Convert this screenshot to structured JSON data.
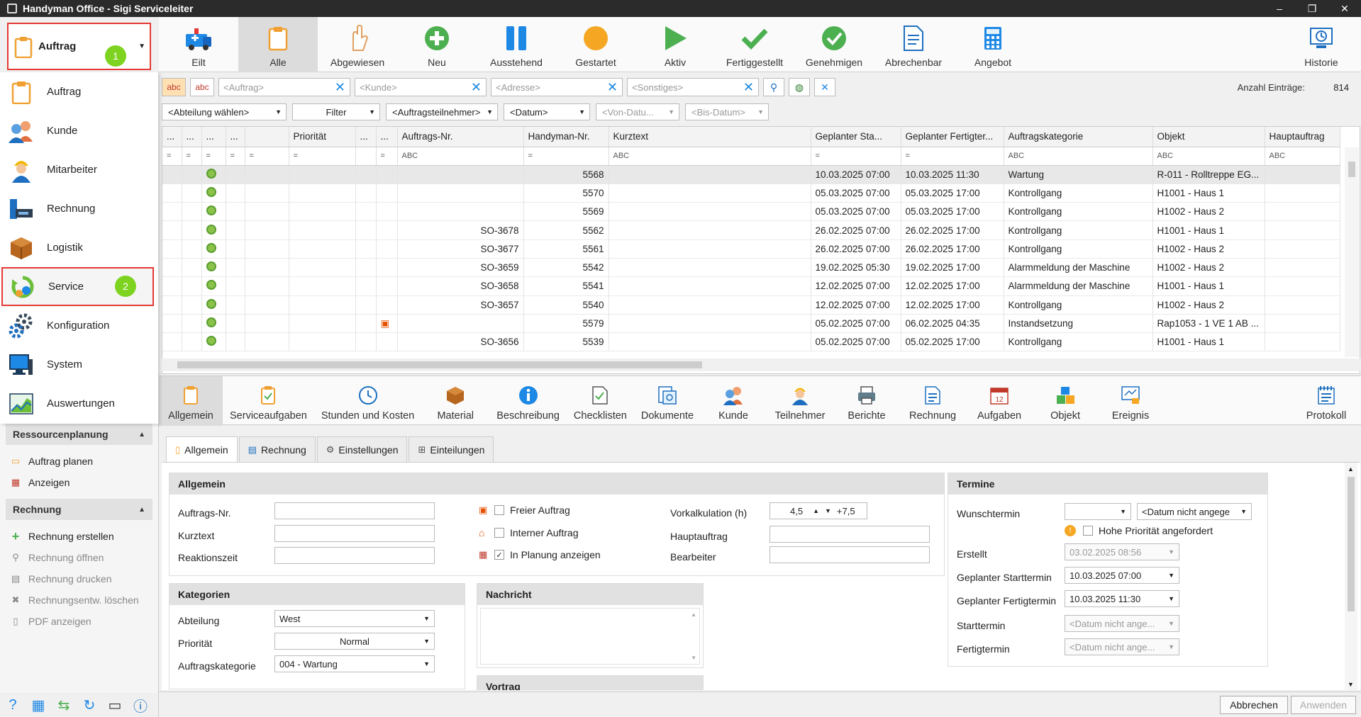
{
  "window": {
    "title": "Handyman Office - Sigi Serviceleiter"
  },
  "module_picker": {
    "label": "Auftrag",
    "badge": "1"
  },
  "modules": [
    {
      "label": "Auftrag",
      "icon": "clipboard-icon"
    },
    {
      "label": "Kunde",
      "icon": "customers-icon"
    },
    {
      "label": "Mitarbeiter",
      "icon": "worker-icon"
    },
    {
      "label": "Rechnung",
      "icon": "invoice-icon"
    },
    {
      "label": "Logistik",
      "icon": "box-icon"
    },
    {
      "label": "Service",
      "icon": "service-icon",
      "badge": "2"
    },
    {
      "label": "Konfiguration",
      "icon": "gears-icon"
    },
    {
      "label": "System",
      "icon": "monitor-icon"
    },
    {
      "label": "Auswertungen",
      "icon": "chart-icon"
    }
  ],
  "sidebar": {
    "ressourcen": {
      "title": "Ressourcenplanung",
      "items": [
        "Auftrag planen",
        "Anzeigen"
      ]
    },
    "rechnung": {
      "title": "Rechnung",
      "items": [
        "Rechnung erstellen",
        "Rechnung öffnen",
        "Rechnung drucken",
        "Rechnungsentw. löschen",
        "PDF anzeigen"
      ]
    }
  },
  "toolbar": [
    "Eilt",
    "Alle",
    "Abgewiesen",
    "Neu",
    "Ausstehend",
    "Gestartet",
    "Aktiv",
    "Fertiggestellt",
    "Genehmigen",
    "Abrechenbar",
    "Angebot"
  ],
  "toolbar_right": "Historie",
  "filters": {
    "abc": "abc",
    "auftrag": "<Auftrag>",
    "kunde": "<Kunde>",
    "adresse": "<Adresse>",
    "sonstiges": "<Sonstiges>",
    "count_label": "Anzahl Einträge:",
    "count_value": "814",
    "abteilung": "<Abteilung wählen>",
    "filter": "Filter",
    "teilnehmer": "<Auftragsteilnehmer>",
    "datum": "<Datum>",
    "von": "<Von-Datu...",
    "bis": "<Bis-Datum>"
  },
  "grid": {
    "columns": [
      "...",
      "...",
      "...",
      "...",
      "",
      "Priorität",
      "...",
      "...",
      "Auftrags-Nr.",
      "Handyman-Nr.",
      "Kurztext",
      "Geplanter Sta...",
      "Geplanter Fertigter...",
      "Auftragskategorie",
      "Objekt",
      "Hauptauftrag"
    ],
    "filter_glyph_eq": "=",
    "filter_glyph_abc": "ABC",
    "rows": [
      {
        "auftrag": "",
        "handyman": "5568",
        "start": "10.03.2025 07:00",
        "ende": "10.03.2025 11:30",
        "kategorie": "Wartung",
        "objekt": "R-011 - Rolltreppe EG..."
      },
      {
        "auftrag": "",
        "handyman": "5570",
        "start": "05.03.2025 07:00",
        "ende": "05.03.2025 17:00",
        "kategorie": "Kontrollgang",
        "objekt": "H1001 - Haus 1"
      },
      {
        "auftrag": "",
        "handyman": "5569",
        "start": "05.03.2025 07:00",
        "ende": "05.03.2025 17:00",
        "kategorie": "Kontrollgang",
        "objekt": "H1002 - Haus 2"
      },
      {
        "auftrag": "SO-3678",
        "handyman": "5562",
        "start": "26.02.2025 07:00",
        "ende": "26.02.2025 17:00",
        "kategorie": "Kontrollgang",
        "objekt": "H1001 - Haus 1"
      },
      {
        "auftrag": "SO-3677",
        "handyman": "5561",
        "start": "26.02.2025 07:00",
        "ende": "26.02.2025 17:00",
        "kategorie": "Kontrollgang",
        "objekt": "H1002 - Haus 2"
      },
      {
        "auftrag": "SO-3659",
        "handyman": "5542",
        "start": "19.02.2025 05:30",
        "ende": "19.02.2025 17:00",
        "kategorie": "Alarmmeldung der Maschine",
        "objekt": "H1002 - Haus 2"
      },
      {
        "auftrag": "SO-3658",
        "handyman": "5541",
        "start": "12.02.2025 07:00",
        "ende": "12.02.2025 17:00",
        "kategorie": "Alarmmeldung der Maschine",
        "objekt": "H1001 - Haus 1"
      },
      {
        "auftrag": "SO-3657",
        "handyman": "5540",
        "start": "12.02.2025 07:00",
        "ende": "12.02.2025 17:00",
        "kategorie": "Kontrollgang",
        "objekt": "H1002 - Haus 2"
      },
      {
        "auftrag": "",
        "handyman": "5579",
        "start": "05.02.2025 07:00",
        "ende": "06.02.2025 04:35",
        "kategorie": "Instandsetzung",
        "objekt": "Rap1053 - 1 VE 1 AB ..."
      },
      {
        "auftrag": "SO-3656",
        "handyman": "5539",
        "start": "05.02.2025 07:00",
        "ende": "05.02.2025 17:00",
        "kategorie": "Kontrollgang",
        "objekt": "H1001 - Haus 1"
      }
    ]
  },
  "subtoolbar": [
    "Allgemein",
    "Serviceaufgaben",
    "Stunden und Kosten",
    "Material",
    "Beschreibung",
    "Checklisten",
    "Dokumente",
    "Kunde",
    "Teilnehmer",
    "Berichte",
    "Rechnung",
    "Aufgaben",
    "Objekt",
    "Ereignis"
  ],
  "subtoolbar_right": "Protokoll",
  "detail_tabs": [
    "Allgemein",
    "Rechnung",
    "Einstellungen",
    "Einteilungen"
  ],
  "allgemein": {
    "title": "Allgemein",
    "labels": [
      "Auftrags-Nr.",
      "Kurztext",
      "Reaktionszeit"
    ],
    "checks": [
      "Freier Auftrag",
      "Interner Auftrag",
      "In Planung anzeigen"
    ],
    "vorkalkulation_label": "Vorkalkulation (h)",
    "vorkalkulation_value": "4,5",
    "vorkalkulation_plus": "+7,5",
    "hauptauftrag_label": "Hauptauftrag",
    "bearbeiter_label": "Bearbeiter"
  },
  "kategorien": {
    "title": "Kategorien",
    "abteilung_label": "Abteilung",
    "abteilung_value": "West",
    "prioritaet_label": "Priorität",
    "prioritaet_value": "Normal",
    "kategorie_label": "Auftragskategorie",
    "kategorie_value": "004 - Wartung"
  },
  "nachricht": {
    "title": "Nachricht",
    "vortrag": "Vortrag"
  },
  "termine": {
    "title": "Termine",
    "wunsch_label": "Wunschtermin",
    "wunsch_value": "<Datum nicht angege",
    "hohe_prio": "Hohe Priorität angefordert",
    "erstellt_label": "Erstellt",
    "erstellt_value": "03.02.2025 08:56",
    "gstart_label": "Geplanter Starttermin",
    "gstart_value": "10.03.2025 07:00",
    "gende_label": "Geplanter Fertigtermin",
    "gende_value": "10.03.2025 11:30",
    "start_label": "Starttermin",
    "start_value": "<Datum nicht ange...",
    "ende_label": "Fertigtermin",
    "ende_value": "<Datum nicht ange..."
  },
  "actions": {
    "cancel": "Abbrechen",
    "apply": "Anwenden"
  }
}
